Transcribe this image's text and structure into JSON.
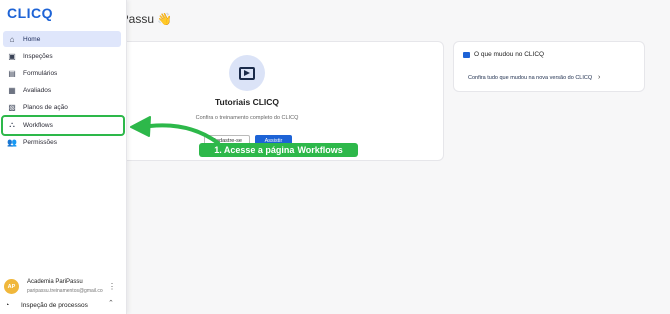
{
  "header": {
    "page_title": "iPassu 👋"
  },
  "tutorial_card": {
    "title": "Tutoriais CLICQ",
    "subtitle": "Confira o treinamento completo do CLICQ",
    "outline_button": "Cadastre-se",
    "primary_button": "Assistir"
  },
  "news_card": {
    "title": "O que mudou no CLICQ",
    "link_text": "Confira tudo que mudou na nova versão do CLICQ",
    "chevron": "›"
  },
  "sidebar": {
    "logo": "CLICQ",
    "items": [
      {
        "label": "Home",
        "icon": "home-icon",
        "glyph": "⌂"
      },
      {
        "label": "Inspeções",
        "icon": "inspection-icon",
        "glyph": "▣"
      },
      {
        "label": "Formulários",
        "icon": "form-icon",
        "glyph": "▤"
      },
      {
        "label": "Avaliados",
        "icon": "evaluated-icon",
        "glyph": "▦"
      },
      {
        "label": "Planos de ação",
        "icon": "action-plan-icon",
        "glyph": "▧"
      },
      {
        "label": "Workflows",
        "icon": "workflow-icon",
        "glyph": "⛬"
      },
      {
        "label": "Permissões",
        "icon": "permissions-icon",
        "glyph": "👥"
      }
    ],
    "user": {
      "initials": "AP",
      "name": "Academia PariPassu",
      "email": "paripassu.treinamentos@gmail.com",
      "more": "⋮"
    },
    "process": {
      "label": "Inspeção de processos",
      "glyph": "◔",
      "chevron": "⌃"
    }
  },
  "annotation": {
    "text": "1. Acesse a página",
    "highlight": "Workflows"
  }
}
